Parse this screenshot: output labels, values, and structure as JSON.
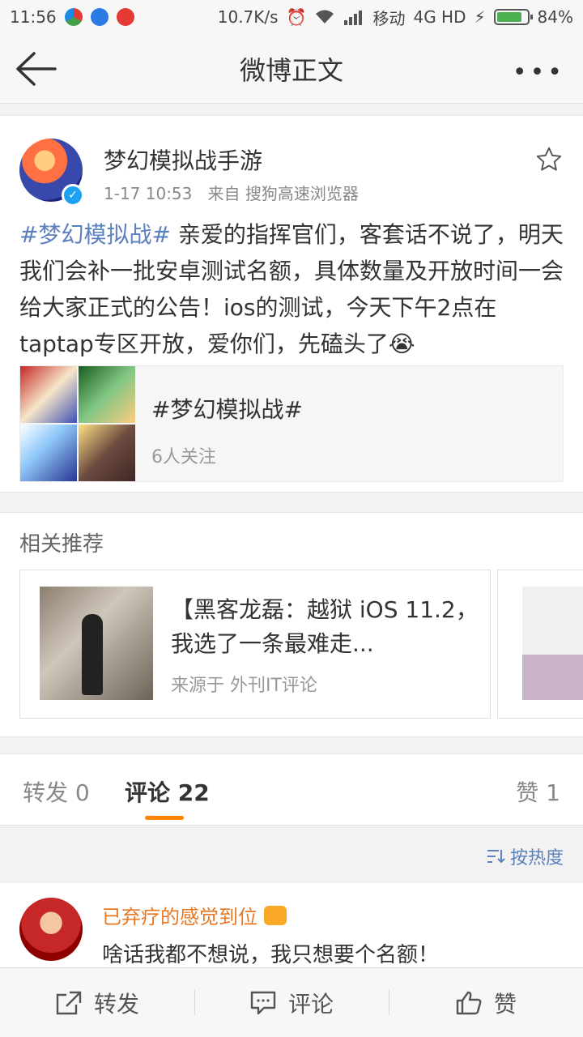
{
  "status_bar": {
    "time": "11:56",
    "network_speed": "10.7K/s",
    "carrier": "移动",
    "network_type": "4G HD",
    "battery": "84%"
  },
  "nav": {
    "title": "微博正文",
    "more": "•••"
  },
  "post": {
    "username": "梦幻模拟战手游",
    "timestamp": "1-17 10:53",
    "source": "来自 搜狗高速浏览器",
    "hashtag": "#梦幻模拟战#",
    "body": " 亲爱的指挥官们，客套话不说了，明天我们会补一批安卓测试名额，具体数量及开放时间一会给大家正式的公告！ios的测试，今天下午2点在taptap专区开放，爱你们，先磕头了😭",
    "topic_name": "#梦幻模拟战#",
    "topic_followers": "6人关注"
  },
  "recommend": {
    "title": "相关推荐",
    "headline": "【黑客龙磊：越狱 iOS 11.2，我选了一条最难走...",
    "source": "来源于 外刊IT评论"
  },
  "tabs": {
    "repost": "转发 0",
    "comments": "评论 22",
    "likes": "赞 1"
  },
  "sort": {
    "label": "按热度"
  },
  "comment": {
    "username": "已弃疗的感觉到位",
    "text": "啥话我都不想说，我只想要个名额！"
  },
  "toolbar": {
    "repost": "转发",
    "comment": "评论",
    "like": "赞"
  },
  "colors": {
    "link_blue": "#5b7fbf",
    "orange_accent": "#ff8200",
    "comment_user": "#e87722"
  }
}
